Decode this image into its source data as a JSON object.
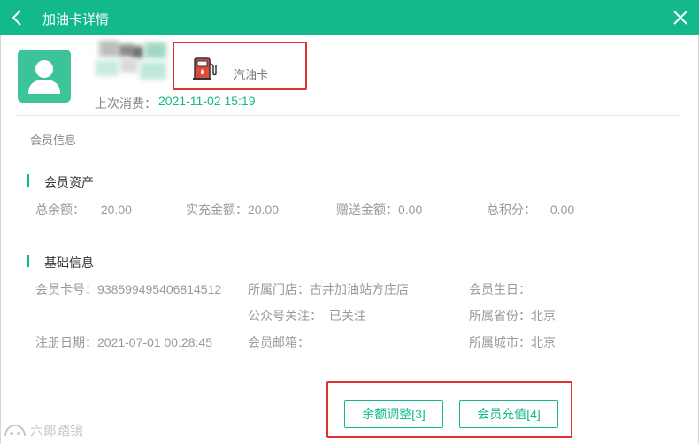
{
  "window": {
    "title": "加油卡详情",
    "back_icon": "chevron-left-icon",
    "close_icon": "close-icon",
    "header_color": "#13b98b"
  },
  "profile": {
    "avatar_icon": "user-avatar-icon",
    "card_type": {
      "icon": "fuel-pump-icon",
      "label": "汽油卡"
    },
    "last_spend_label": "上次消费：",
    "last_spend_value": "2021-11-02 15:19"
  },
  "section_title": "会员信息",
  "assets": {
    "heading": "会员资产",
    "items": [
      {
        "label": "总余额：",
        "value": "20.00"
      },
      {
        "label": "实充金额：",
        "value": "20.00"
      },
      {
        "label": "赠送金额：",
        "value": "0.00"
      },
      {
        "label": "总积分：",
        "value": "0.00"
      }
    ]
  },
  "basic": {
    "heading": "基础信息",
    "card_no": {
      "label": "会员卡号：",
      "value": "938599495406814512"
    },
    "store": {
      "label": "所属门店：",
      "value": "古井加油站方庄店"
    },
    "birthday": {
      "label": "会员生日：",
      "value": ""
    },
    "wechat": {
      "label": "公众号关注：",
      "value": "已关注"
    },
    "province": {
      "label": "所属省份：",
      "value": "北京"
    },
    "reg_date": {
      "label": "注册日期：",
      "value": "2021-07-01 00:28:45"
    },
    "email": {
      "label": "会员邮箱：",
      "value": ""
    },
    "city": {
      "label": "所属城市：",
      "value": "北京"
    }
  },
  "actions": {
    "adjust_balance": "余额调整[3]",
    "recharge": "会员充值[4]"
  },
  "watermark": "六郎踏镜",
  "colors": {
    "accent": "#13b98b",
    "highlight_box": "#e03030"
  }
}
